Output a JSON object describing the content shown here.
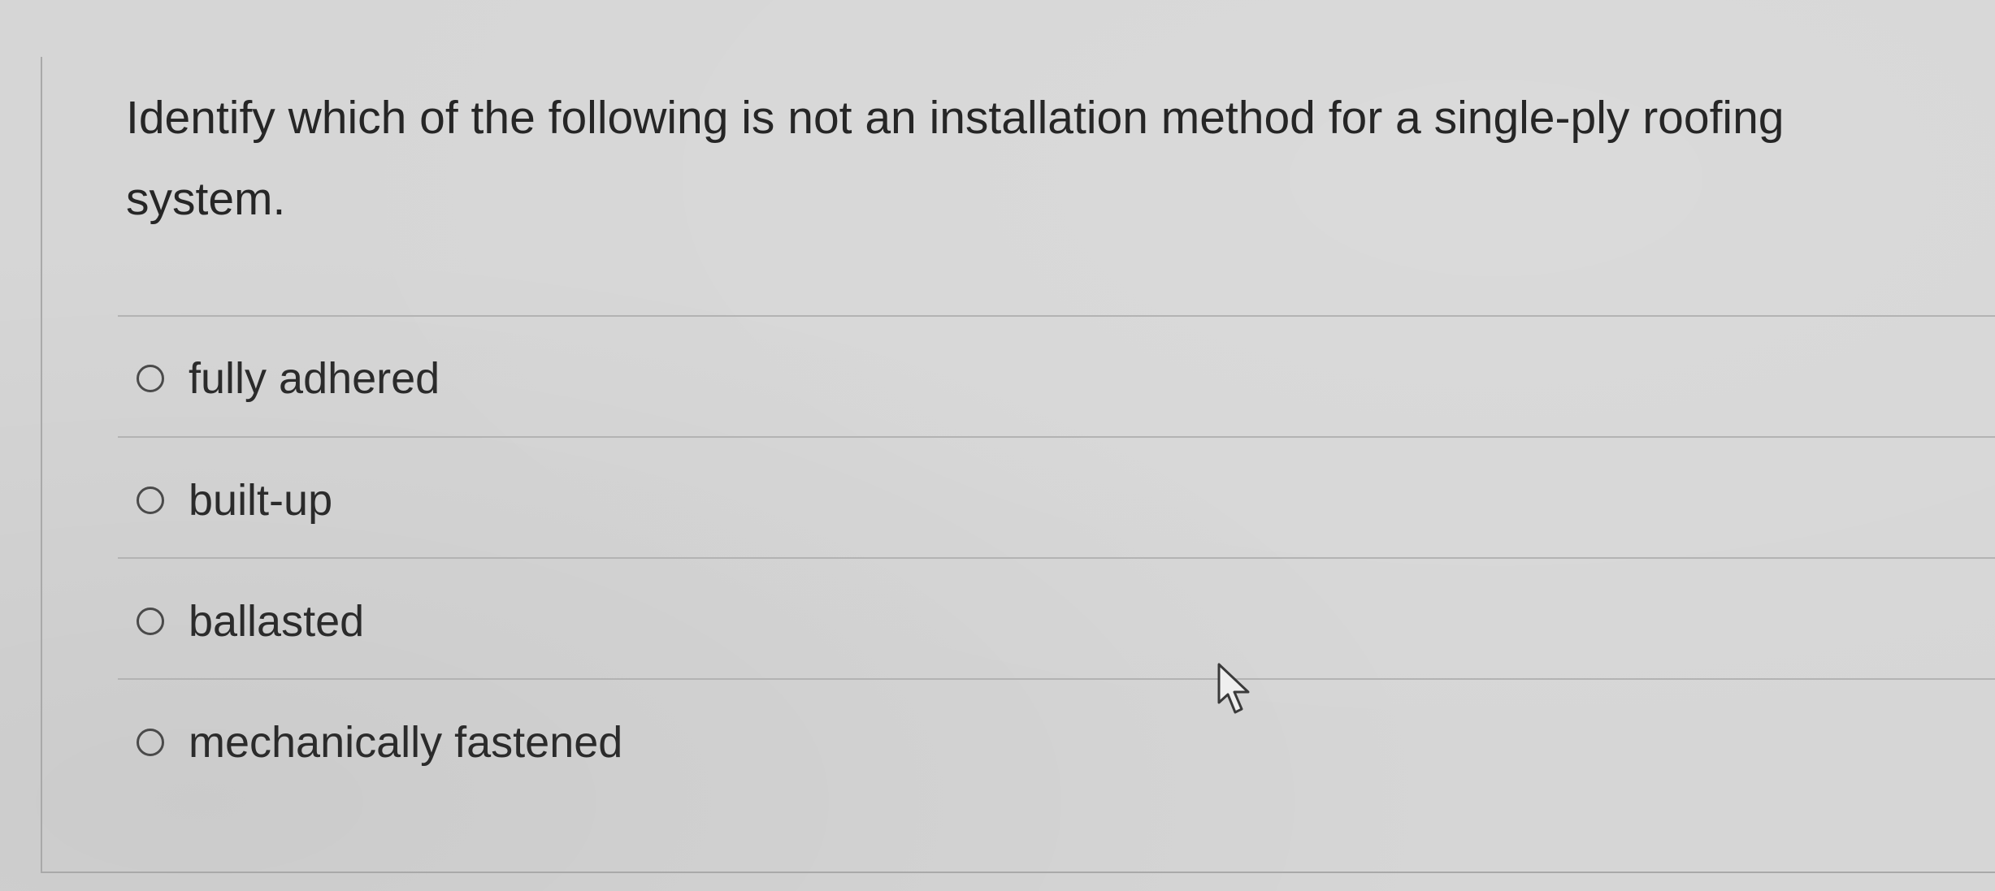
{
  "question": {
    "text": "Identify which of the following is not an installation method for a single-ply roofing system."
  },
  "options": [
    {
      "label": "fully adhered",
      "selected": false
    },
    {
      "label": "built-up",
      "selected": false
    },
    {
      "label": "ballasted",
      "selected": false
    },
    {
      "label": "mechanically fastened",
      "selected": false
    }
  ],
  "cursor": {
    "icon": "arrow-pointer-icon"
  }
}
